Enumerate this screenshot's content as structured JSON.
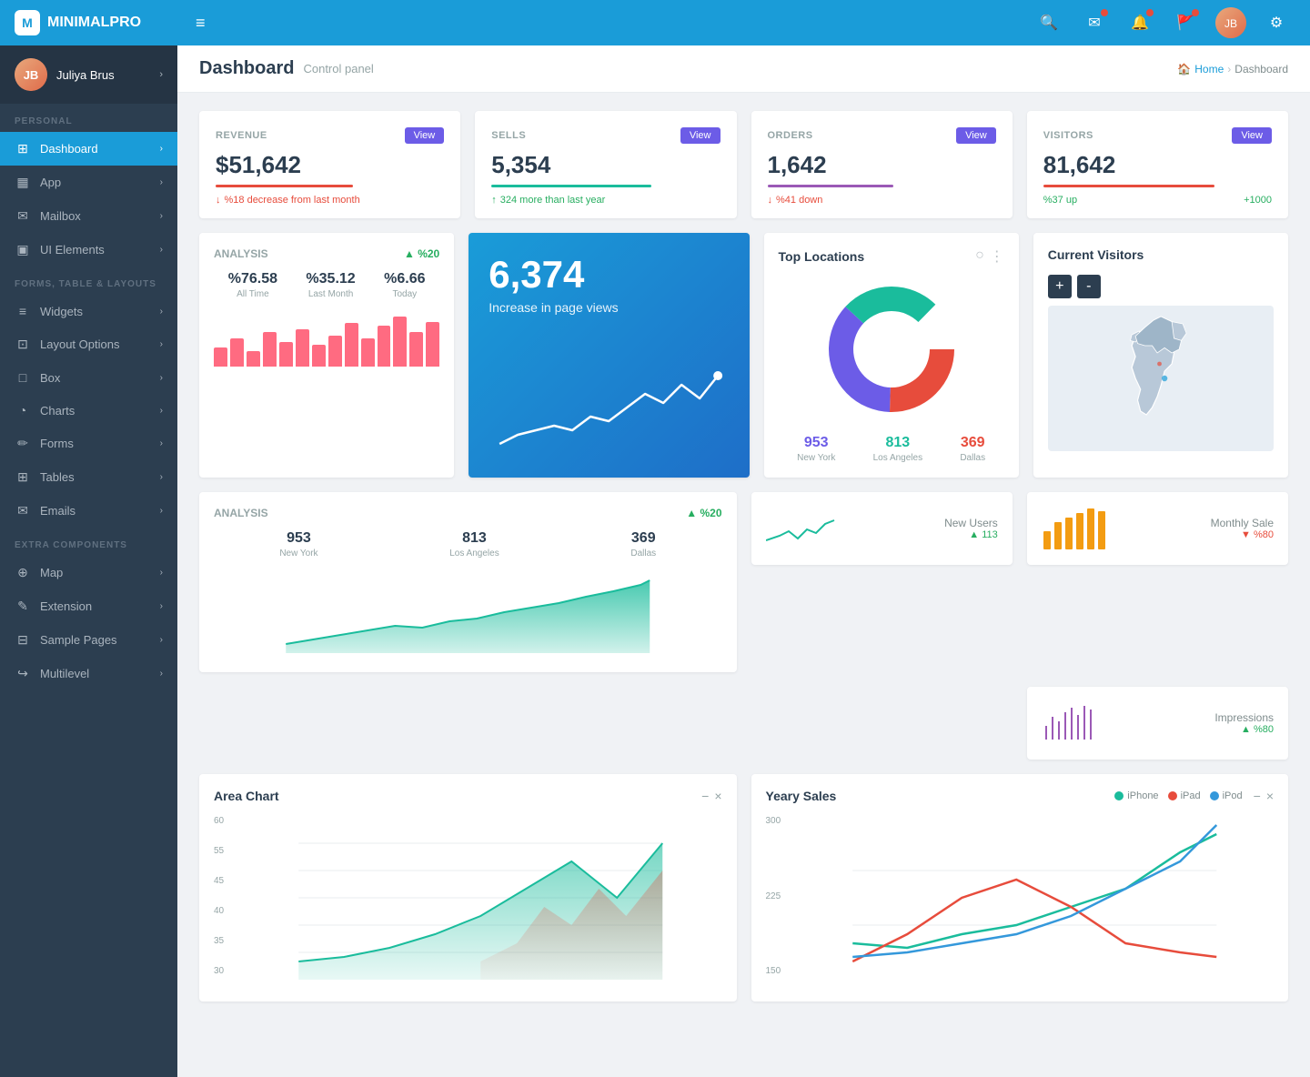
{
  "app": {
    "name": "MINIMALPRO",
    "logo_initial": "M"
  },
  "sidebar": {
    "user": {
      "name": "Juliya Brus",
      "initial": "JB"
    },
    "sections": [
      {
        "label": "PERSONAL",
        "items": [
          {
            "id": "dashboard",
            "label": "Dashboard",
            "icon": "⊞",
            "active": true
          },
          {
            "id": "app",
            "label": "App",
            "icon": "▦"
          },
          {
            "id": "mailbox",
            "label": "Mailbox",
            "icon": "✉"
          },
          {
            "id": "ui-elements",
            "label": "UI Elements",
            "icon": "▣"
          }
        ]
      },
      {
        "label": "FORMS, TABLE & LAYOUTS",
        "items": [
          {
            "id": "widgets",
            "label": "Widgets",
            "icon": "≡"
          },
          {
            "id": "layout-options",
            "label": "Layout Options",
            "icon": "⊡"
          },
          {
            "id": "box",
            "label": "Box",
            "icon": "□"
          },
          {
            "id": "charts",
            "label": "Charts",
            "icon": "◔"
          },
          {
            "id": "forms",
            "label": "Forms",
            "icon": "✏"
          },
          {
            "id": "tables",
            "label": "Tables",
            "icon": "⊞"
          },
          {
            "id": "emails",
            "label": "Emails",
            "icon": "✉"
          }
        ]
      },
      {
        "label": "EXTRA COMPONENTS",
        "items": [
          {
            "id": "map",
            "label": "Map",
            "icon": "⊕"
          },
          {
            "id": "extension",
            "label": "Extension",
            "icon": "✎"
          },
          {
            "id": "sample-pages",
            "label": "Sample Pages",
            "icon": "⊟"
          },
          {
            "id": "multilevel",
            "label": "Multilevel",
            "icon": "↪"
          }
        ]
      }
    ]
  },
  "topbar": {
    "hamburger": "≡",
    "icons": [
      "search",
      "mail",
      "bell",
      "flag",
      "avatar",
      "gear"
    ]
  },
  "header": {
    "title": "Dashboard",
    "subtitle": "Control panel",
    "breadcrumb": {
      "home": "Home",
      "current": "Dashboard"
    }
  },
  "stats": [
    {
      "label": "REVENUE",
      "value": "$51,642",
      "bar_color": "#e74c3c",
      "bar_width": "60%",
      "trend": "%18 decrease from last month",
      "trend_type": "down",
      "btn": "View"
    },
    {
      "label": "SELLS",
      "value": "5,354",
      "bar_color": "#1abc9c",
      "bar_width": "70%",
      "trend": "324 more than last year",
      "trend_type": "up",
      "btn": "View"
    },
    {
      "label": "ORDERS",
      "value": "1,642",
      "bar_color": "#9b59b6",
      "bar_width": "55%",
      "trend": "%41 down",
      "trend_type": "down",
      "btn": "View"
    },
    {
      "label": "VISITORS",
      "value": "81,642",
      "bar_color": "#e74c3c",
      "bar_width": "75%",
      "trend_left": "%37 up",
      "trend_right": "+1000",
      "trend_type": "up",
      "btn": "View"
    }
  ],
  "analysis1": {
    "title": "ANALYSIS",
    "pct": "▲ %20",
    "stats": [
      {
        "val": "%76.58",
        "lbl": "All Time"
      },
      {
        "val": "%35.12",
        "lbl": "Last Month"
      },
      {
        "val": "%6.66",
        "lbl": "Today"
      }
    ],
    "bars": [
      30,
      45,
      25,
      55,
      40,
      60,
      35,
      50,
      70,
      45,
      65,
      80,
      55,
      72
    ]
  },
  "hero": {
    "number": "6,374",
    "label": "Increase in page views"
  },
  "analysis2": {
    "title": "ANALYSIS",
    "pct": "▲ %20",
    "stats": [
      {
        "val": "953",
        "lbl": "New York"
      },
      {
        "val": "813",
        "lbl": "Los Angeles"
      },
      {
        "val": "369",
        "lbl": "Dallas"
      }
    ]
  },
  "locations": {
    "title": "Top Locations",
    "donut": [
      {
        "label": "New York",
        "value": 953,
        "color": "#6c5ce7",
        "pct": 35
      },
      {
        "label": "Los Angeles",
        "value": 813,
        "color": "#1abc9c",
        "pct": 30
      },
      {
        "label": "Dallas",
        "value": 369,
        "color": "#e74c3c",
        "pct": 14
      }
    ]
  },
  "current_visitors": {
    "title": "Current Visitors",
    "zoom_in": "+",
    "zoom_out": "-"
  },
  "metrics": [
    {
      "label": "New Users",
      "value": "113",
      "trend": "▲ 113",
      "color": "#1abc9c",
      "trend_type": "up"
    },
    {
      "label": "Monthly Sale",
      "value": "%80",
      "trend": "▼ %80",
      "color": "#f39c12",
      "trend_type": "down"
    },
    {
      "label": "Impressions",
      "value": "%80",
      "trend": "▲ %80",
      "color": "#9b59b6",
      "trend_type": "up"
    }
  ],
  "area_chart": {
    "title": "Area Chart",
    "y_labels": [
      "60",
      "55",
      "45",
      "40",
      "35",
      "30"
    ]
  },
  "yearly_sales": {
    "title": "Yeary Sales",
    "legend": [
      {
        "label": "iPhone",
        "color": "#1abc9c"
      },
      {
        "label": "iPad",
        "color": "#e74c3c"
      },
      {
        "label": "iPod",
        "color": "#3498db"
      }
    ],
    "y_labels": [
      "300",
      "225",
      "150"
    ]
  }
}
